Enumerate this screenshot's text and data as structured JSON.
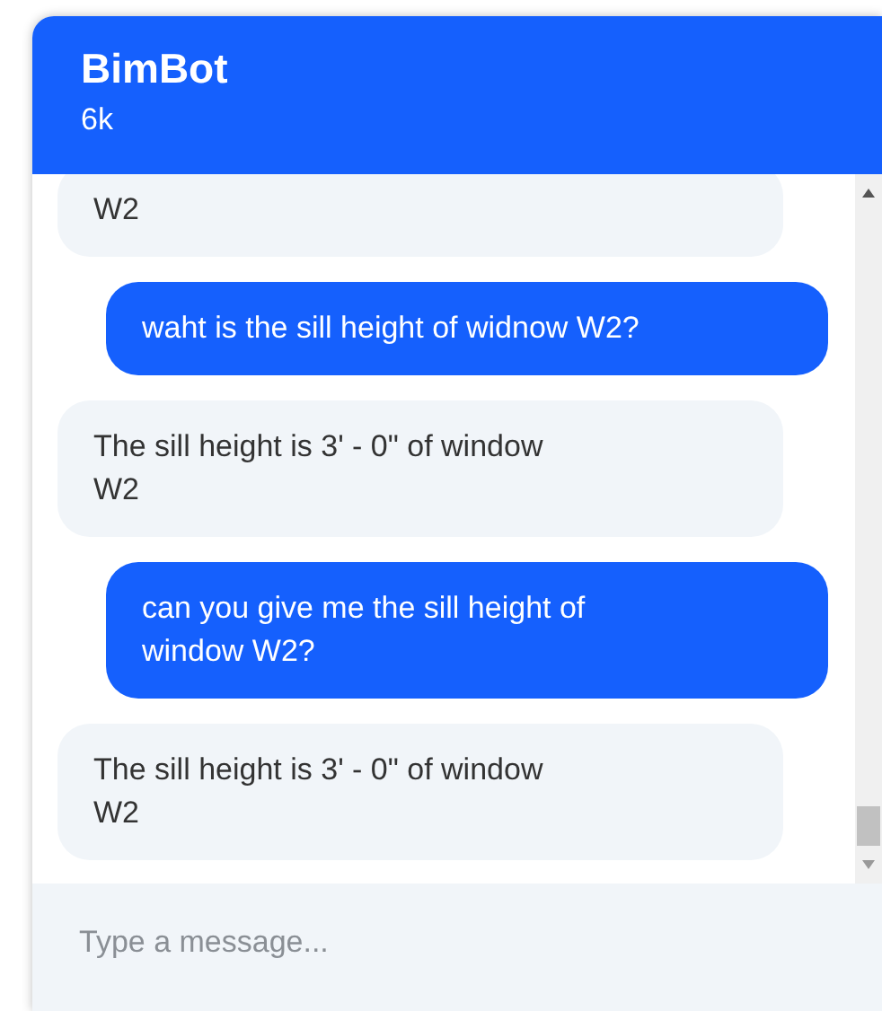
{
  "header": {
    "title": "BimBot",
    "subtitle": "6k"
  },
  "messages": [
    {
      "kind": "bot",
      "text": "W2"
    },
    {
      "kind": "user",
      "text": "waht is the sill height of widnow W2?"
    },
    {
      "kind": "bot",
      "text": "The sill height is 3' - 0\" of window W2"
    },
    {
      "kind": "user",
      "text": "can you give me the sill height of window W2?"
    },
    {
      "kind": "bot",
      "text": "The sill height is 3' - 0\" of window W2"
    }
  ],
  "composer": {
    "placeholder": "Type a message..."
  }
}
